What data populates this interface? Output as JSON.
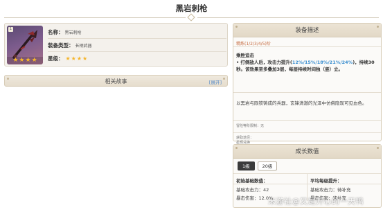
{
  "page": {
    "title": "黑岩刺枪"
  },
  "item": {
    "badge": "1",
    "rows": [
      {
        "key": "名称：",
        "value": "黑岩刺枪"
      },
      {
        "key": "装备类型：",
        "value": "长柄武器"
      },
      {
        "key": "星级：",
        "stars": 4
      }
    ],
    "image_stars": 4
  },
  "story": {
    "label": "相关故事",
    "expand": "[展开]"
  },
  "description": {
    "title": "装备描述",
    "refine": "精炼(1/2/3/4/5)阶",
    "passive_name": "乘胜追击",
    "effect_prefix": "• 打倒敌人后，攻击力提升(",
    "effect_values": "12%/15%/18%/21%/24%",
    "effect_suffix": ")，持续30秒。该效果至多叠加3层，每层持续时间独（竖）立。",
    "lore": "以黑岩与陨铁铸成的兵器，玄锋清澈的光泽中仿佛隐现可见血色。",
    "misc": "冒险等阶限制：无",
    "source_label": "获取途径：",
    "source_value": "星辉兑换"
  },
  "growth": {
    "title": "成长数值",
    "levels": [
      "1级",
      "20级"
    ],
    "active_level": "1级",
    "left_head": "初始基础数值：",
    "left_lines": [
      "基础攻击力：42",
      "暴击伤害：12.0%"
    ],
    "right_head": "平均每级提升：",
    "right_lines": [
      "基础攻击力：待补充",
      "暴击伤害：待补充"
    ]
  },
  "watermark": "米游社@又是开心的一天鸭",
  "colors": {
    "accent_blue": "#3c8fd0",
    "refine_orange": "#c56a3f",
    "star": "#f5b429"
  }
}
